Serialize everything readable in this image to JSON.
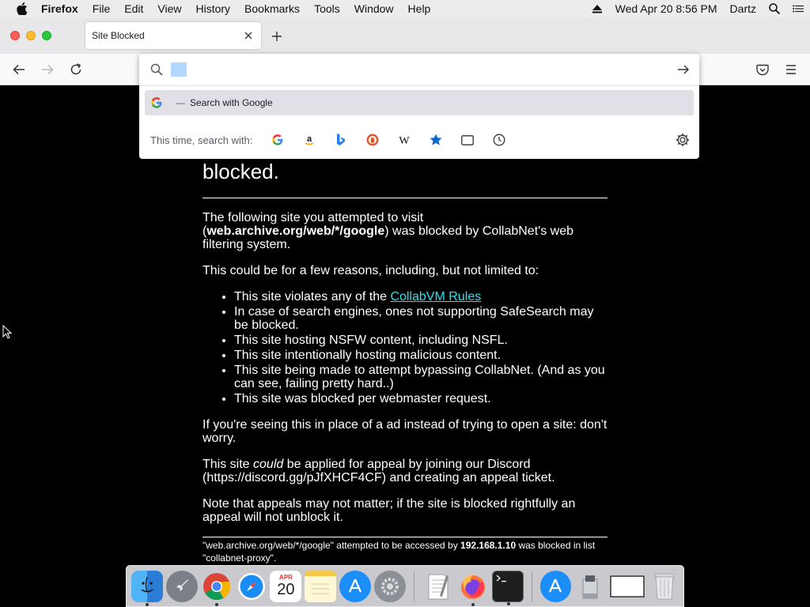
{
  "menubar": {
    "app": "Firefox",
    "items": [
      "File",
      "Edit",
      "View",
      "History",
      "Bookmarks",
      "Tools",
      "Window",
      "Help"
    ],
    "datetime": "Wed Apr 20  8:56 PM",
    "user": "Dartz"
  },
  "tab": {
    "title": "Site Blocked"
  },
  "urlbar": {
    "query": "",
    "suggestion_query": "",
    "suggestion_sep": "—",
    "suggestion_suffix": "Search with Google",
    "oneoff_label": "This time, search with:",
    "engines": [
      "Google",
      "Amazon",
      "Bing",
      "DuckDuckGo",
      "Wikipedia",
      "Bookmarks",
      "Tabs",
      "History"
    ]
  },
  "page": {
    "heading": "blocked.",
    "intro_before": "The following site you attempted to visit (",
    "blocked_url": "web.archive.org/web/*/google",
    "intro_after": ") was blocked by CollabNet's web filtering system.",
    "reasons_intro": "This could be for a few reasons, including, but not limited to:",
    "reason1_before": "This site violates any of the ",
    "rules_link": "CollabVM Rules",
    "reason2": "In case of search engines, ones not supporting SafeSearch may be blocked.",
    "reason3": "This site hosting NSFW content, including NSFL.",
    "reason4": "This site intentionally hosting malicious content.",
    "reason5": "This site being made to attempt bypassing CollabNet. (And as you can see, failing pretty hard..)",
    "reason6": "This site was blocked per webmaster request.",
    "ad_note": "If you're seeing this in place of a ad instead of trying to open a site: don't worry.",
    "appeal_before": "This site ",
    "appeal_em": "could",
    "appeal_after": " be applied for appeal by joining our Discord (https://discord.gg/pJfXHCF4CF) and creating an appeal ticket.",
    "note": "Note that appeals may not matter; if the site is blocked rightfully an appeal will not unblock it.",
    "footer_before": "\"web.archive.org/web/*/google\" attempted to be accessed by ",
    "footer_ip": "192.168.1.10",
    "footer_after": " was blocked in list \"collabnet-proxy\"."
  },
  "dock": {
    "apps": [
      "Finder",
      "Launchpad",
      "Chrome",
      "Safari",
      "Calendar",
      "Notes",
      "App Store",
      "System Preferences",
      "TextEdit",
      "Firefox",
      "Terminal",
      "Applications",
      "Disk",
      "Window",
      "Trash"
    ],
    "calendar_month": "APR",
    "calendar_day": "20"
  },
  "colors": {
    "link": "#2de0f0",
    "page_bg": "#000000",
    "selection": "#b3d7ff"
  }
}
